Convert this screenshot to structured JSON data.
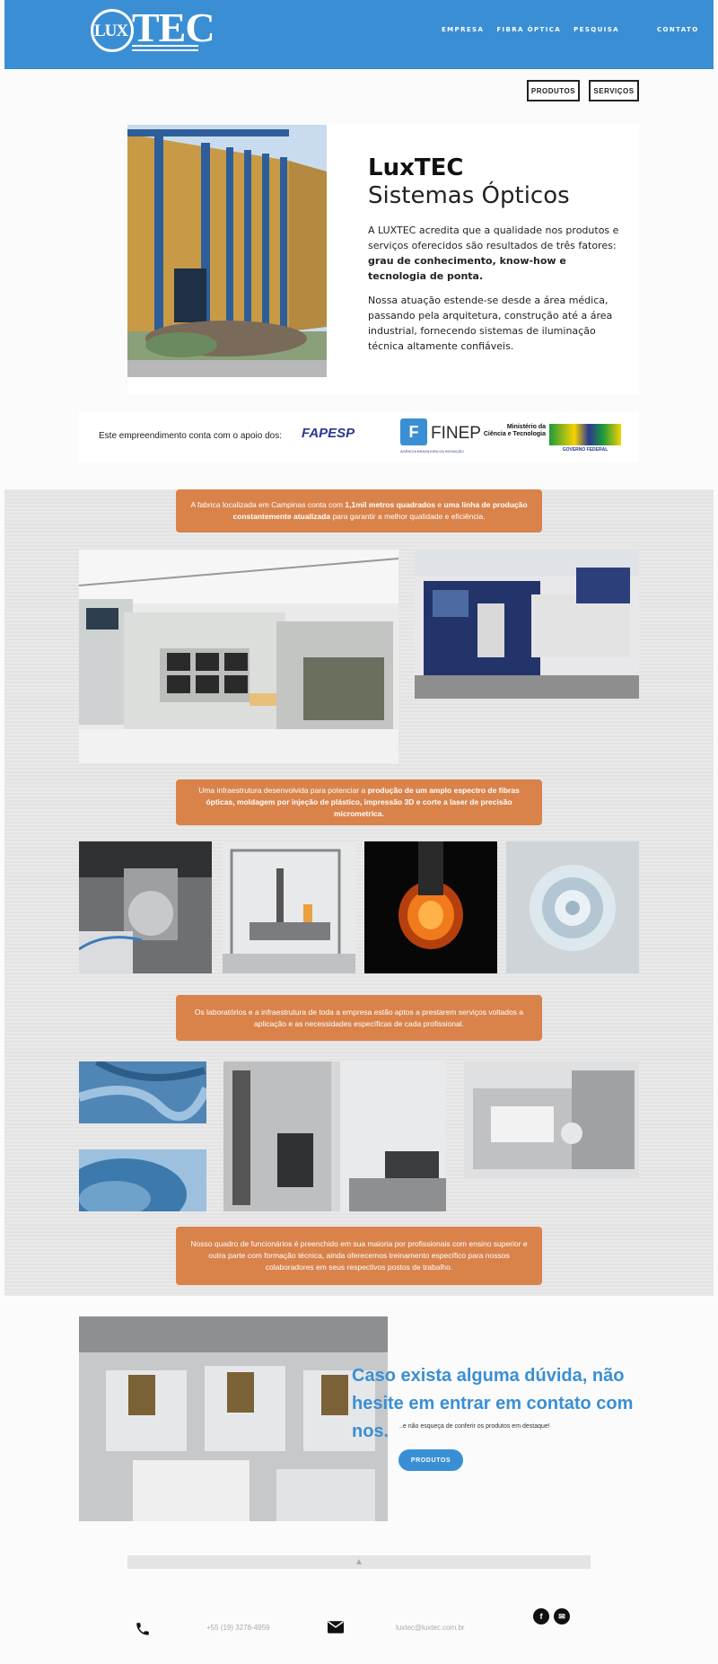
{
  "header": {
    "logo_lux": "LUX",
    "logo_tec": "TEC",
    "nav": [
      "EMPRESA",
      "FIBRA ÓPTICA",
      "PESQUISA",
      "CONTATO"
    ]
  },
  "top_buttons": {
    "products": "PRODUTOS",
    "services": "SERVIÇOS"
  },
  "hero": {
    "title_bold": "LuxTEC",
    "title_light": "Sistemas Ópticos",
    "p1": "A LUXTEC acredita que a qualidade nos produtos e serviços oferecidos são resultados de três fatores:",
    "p1_bold": "grau de conhecimento, know-how e tecnologia de ponta.",
    "p2": "Nossa atuação estende-se desde a área médica, passando pela arquitetura, construção até a área industrial, fornecendo sistemas de iluminação técnica altamente confiáveis."
  },
  "sponsors": {
    "text": "Este empreendimento conta com o apoio dos:",
    "fapesp": "FAPESP",
    "finep": "FINEP",
    "finep_sub": "AGÊNCIA BRASILEIRA DA INOVAÇÃO",
    "mct_line1": "Ministério da",
    "mct_line2": "Ciência e Tecnologia",
    "brasil_sub": "GOVERNO FEDERAL"
  },
  "sections": {
    "s1_pre": "A fabrica localizada em Campinas conta com ",
    "s1_b1": "1,1mil metros quadrados",
    "s1_mid": " e ",
    "s1_b2": "uma linha de produção constantemente atualizada",
    "s1_post": " para garantir a melhor qualidade e eficiência.",
    "s2_pre": "Uma infraestrutura desenvolvida para potenciar a ",
    "s2_b": "produção de um amplo espectro de fibras ópticas, moldagem por injeção de plástico, impressão 3D e corte a laser de precisão micrometrica.",
    "s3": "Os laboratórios e a infraestrutura de toda a empresa estão aptos a prestarem serviços voltados a aplicação e as necessidades específicas de cada profissional.",
    "s4": "Nosso quadro de funcionários é preenchido em sua maioria por profissionais com ensino superior e outra parte com formação técnica, ainda oferecemos treinamento específico para nossos colaboradores em seus respectivos postos de trabalho."
  },
  "contact": {
    "title": "Caso exista alguma dúvida, não hesite em entrar em contato com nos.",
    "sub": "..e não esqueça de conferir os produtos em destaque!",
    "button": "PRODUTOS"
  },
  "footer": {
    "phone": "+55 (19) 3278-4959",
    "email": "luxtec@luxtec.com.br",
    "scroll_glyph": "▲",
    "facebook_glyph": "f",
    "mail_glyph": "✉"
  }
}
